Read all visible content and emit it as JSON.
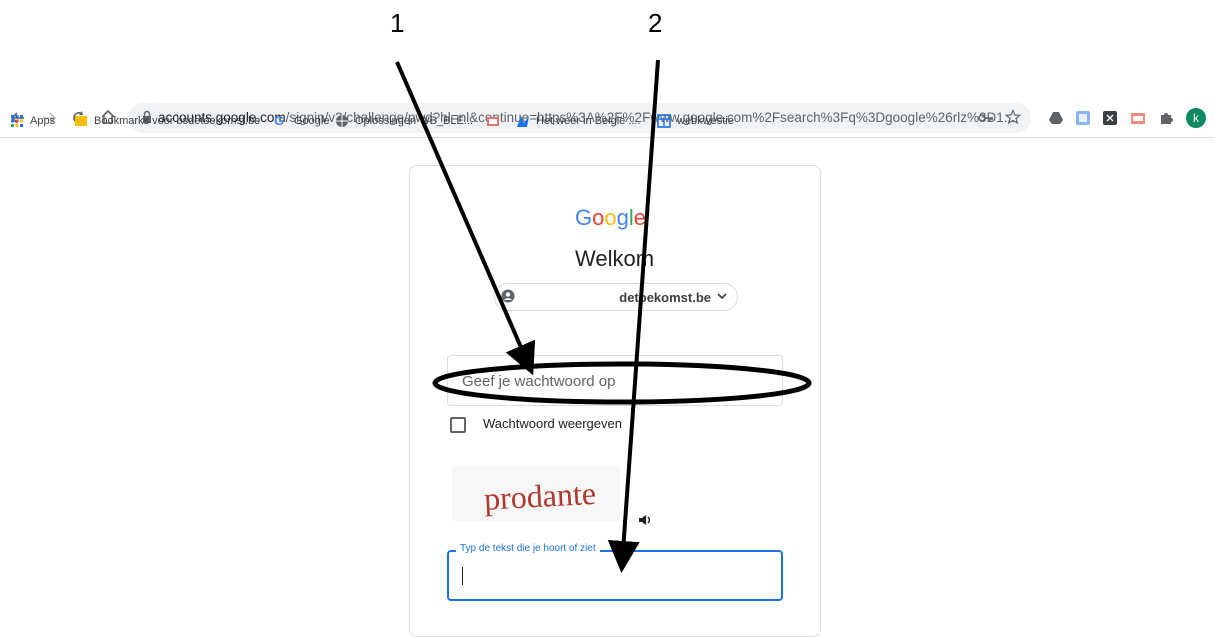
{
  "annotations": {
    "label_1": "1",
    "label_2": "2"
  },
  "browser": {
    "nav_icons": [
      "back-arrow-icon",
      "forward-arrow-icon",
      "reload-icon",
      "home-icon"
    ],
    "address": {
      "host": "accounts.google.com",
      "path": "/signin/v2/challenge/pwd?hl=nl&continue=https%3A%2F%2Fwww.google.com%2Fsearch%3Fq%3Dgoogle%26rlz%3D1..."
    },
    "omnibox_icons": [
      "key-icon",
      "star-icon"
    ],
    "extensions": [
      "drive-icon",
      "extension-blue-icon",
      "extension-dark-icon",
      "pdf-icon",
      "puzzle-icon"
    ],
    "profile_initial": "k",
    "accent_color": "#1a73e8"
  },
  "bookmarks": [
    {
      "label": "Apps",
      "icon": "apps-grid-icon"
    },
    {
      "label": "Bookmarks voor bsdetoekomst.be",
      "icon": "folder-icon"
    },
    {
      "label": "Google",
      "icon": "google-g-icon"
    },
    {
      "label": "Oplossingen WB_BLE...",
      "icon": "globe-icon"
    },
    {
      "label": "",
      "icon": "mail-icon"
    },
    {
      "label": "Het weer in België :...",
      "icon": "weather-icon"
    },
    {
      "label": "webkwestie",
      "icon": "table-icon"
    }
  ],
  "signin": {
    "logo": "Google",
    "heading": "Welkom",
    "account_email": "detoekomst.be",
    "password_placeholder": "Geef je wachtwoord op",
    "show_password_label": "Wachtwoord weergeven",
    "captcha_text": "prodante",
    "captcha_field_label": "Typ de tekst die je hoort of ziet",
    "captcha_value": ""
  }
}
